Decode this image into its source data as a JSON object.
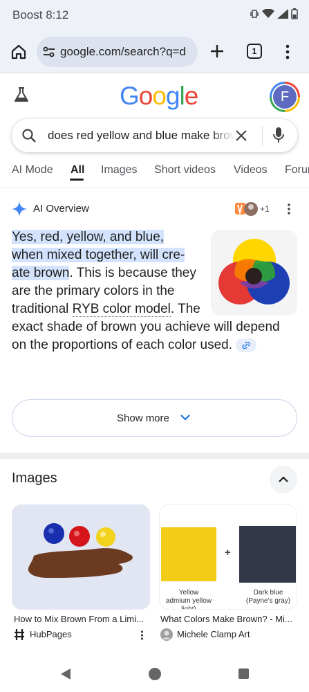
{
  "status_bar": {
    "carrier_time": "Boost 8:12"
  },
  "browser": {
    "url": "google.com/search?q=d",
    "tab_count": "1"
  },
  "logo": {
    "letters": [
      {
        "ch": "G",
        "color": "#4285f4"
      },
      {
        "ch": "o",
        "color": "#ea4335"
      },
      {
        "ch": "o",
        "color": "#fbbc05"
      },
      {
        "ch": "g",
        "color": "#4285f4"
      },
      {
        "ch": "l",
        "color": "#34a853"
      },
      {
        "ch": "e",
        "color": "#ea4335"
      }
    ]
  },
  "account": {
    "initial": "F"
  },
  "search": {
    "query": "does red yellow and blue make brown"
  },
  "tabs": [
    "AI Mode",
    "All",
    "Images",
    "Short videos",
    "Videos",
    "Forums"
  ],
  "active_tab": "All",
  "ai_overview": {
    "title": "AI Overview",
    "sources_more": "+1",
    "highlight_line1": "Yes, red, yellow, and blue,",
    "highlight_line2": "when mixed together, will cre-",
    "highlight_line3": "ate brown",
    "text_a": ". This is because they are the primary colors in the traditional ",
    "link_text": "RYB color model",
    "text_b": ". The",
    "text_c": "exact shade of brown you achieve will depend on the proportions of each color used.",
    "show_more": "Show more"
  },
  "images_section": {
    "heading": "Images",
    "cards": [
      {
        "title": "How to Mix Brown From a Limi...",
        "source": "HubPages"
      },
      {
        "title": "What Colors Make Brown? - Mi...",
        "source": "Michele Clamp Art",
        "image_text": {
          "left_label_1": "Yellow",
          "left_label_2": "admium yellow light)",
          "right_label_1": "Dark blue",
          "right_label_2": "(Payne's gray)",
          "plus": "+"
        }
      }
    ]
  },
  "colors": {
    "accent": "#1a73e8",
    "highlight": "#d3e3fd",
    "ai_star": "#4285f4"
  }
}
